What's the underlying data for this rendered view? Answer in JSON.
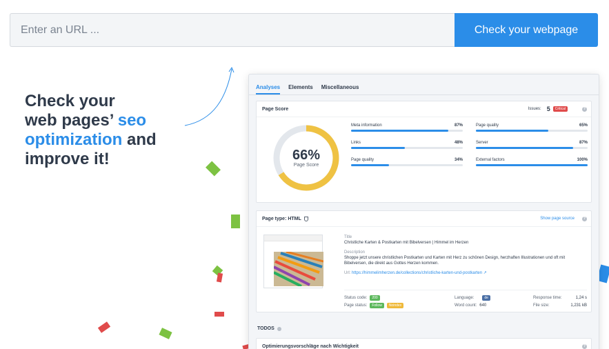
{
  "search": {
    "placeholder": "Enter an URL ...",
    "button_label": "Check your webpage"
  },
  "headline": {
    "line1": "Check your",
    "line2a": "web pages’ ",
    "line2b": "seo",
    "line3a": "optimization",
    "line3b": " and",
    "line4": "improve it!"
  },
  "preview": {
    "tabs": [
      {
        "label": "Analyses",
        "active": true
      },
      {
        "label": "Elements",
        "active": false
      },
      {
        "label": "Miscellaneous",
        "active": false
      }
    ],
    "page_score": {
      "title": "Page Score",
      "issues_label": "Issues:",
      "issues_count": "5",
      "critical_label": "Critical",
      "score_value": "66%",
      "score_fraction": 0.66,
      "score_caption": "Page Score",
      "metrics": [
        {
          "label": "Meta information",
          "pct": "87%",
          "value": 0.87
        },
        {
          "label": "Page quality",
          "pct": "65%",
          "value": 0.65
        },
        {
          "label": "Links",
          "pct": "48%",
          "value": 0.48
        },
        {
          "label": "Server",
          "pct": "87%",
          "value": 0.87
        },
        {
          "label": "Page quality",
          "pct": "34%",
          "value": 0.34
        },
        {
          "label": "External factors",
          "pct": "100%",
          "value": 1.0
        }
      ]
    },
    "page_type": {
      "title": "Page type: HTML",
      "show_source": "Show page source",
      "title_label": "Title",
      "title_value": "Christliche Karten & Postkarten mit Bibelversen | Himmel im Herzen",
      "description_label": "Description",
      "description_value": "Shoppe jetzt unsere christlichen Postkarten und Karten mit Herz zu schönen Design, herzhaften Illustrationen und oft mit Bibelversen, die direkt aus Gottes Herzen kommen.",
      "url_label": "Url:",
      "url_value": "https://himmelimherzen.de/collections/christliche-karten-und-postkarten",
      "stats": {
        "status_code_label": "Status code:",
        "status_code_value": "200",
        "language_label": "Language:",
        "language_value": "de",
        "response_time_label": "Response time:",
        "response_time_value": "1,24 s",
        "page_status_label": "Page status:",
        "follow_label": "Follow",
        "noindex_label": "Noindex",
        "word_count_label": "Word count:",
        "word_count_value": "640",
        "file_size_label": "File size:",
        "file_size_value": "1,231 kB"
      }
    },
    "todos_label": "TODOS",
    "optimization_title": "Optimierungsvorschläge nach Wichtigkeit"
  },
  "colors": {
    "accent": "#2b8de8",
    "donut_fill": "#efc243",
    "donut_track": "#e3e7ec",
    "critical": "#e04b4b"
  }
}
